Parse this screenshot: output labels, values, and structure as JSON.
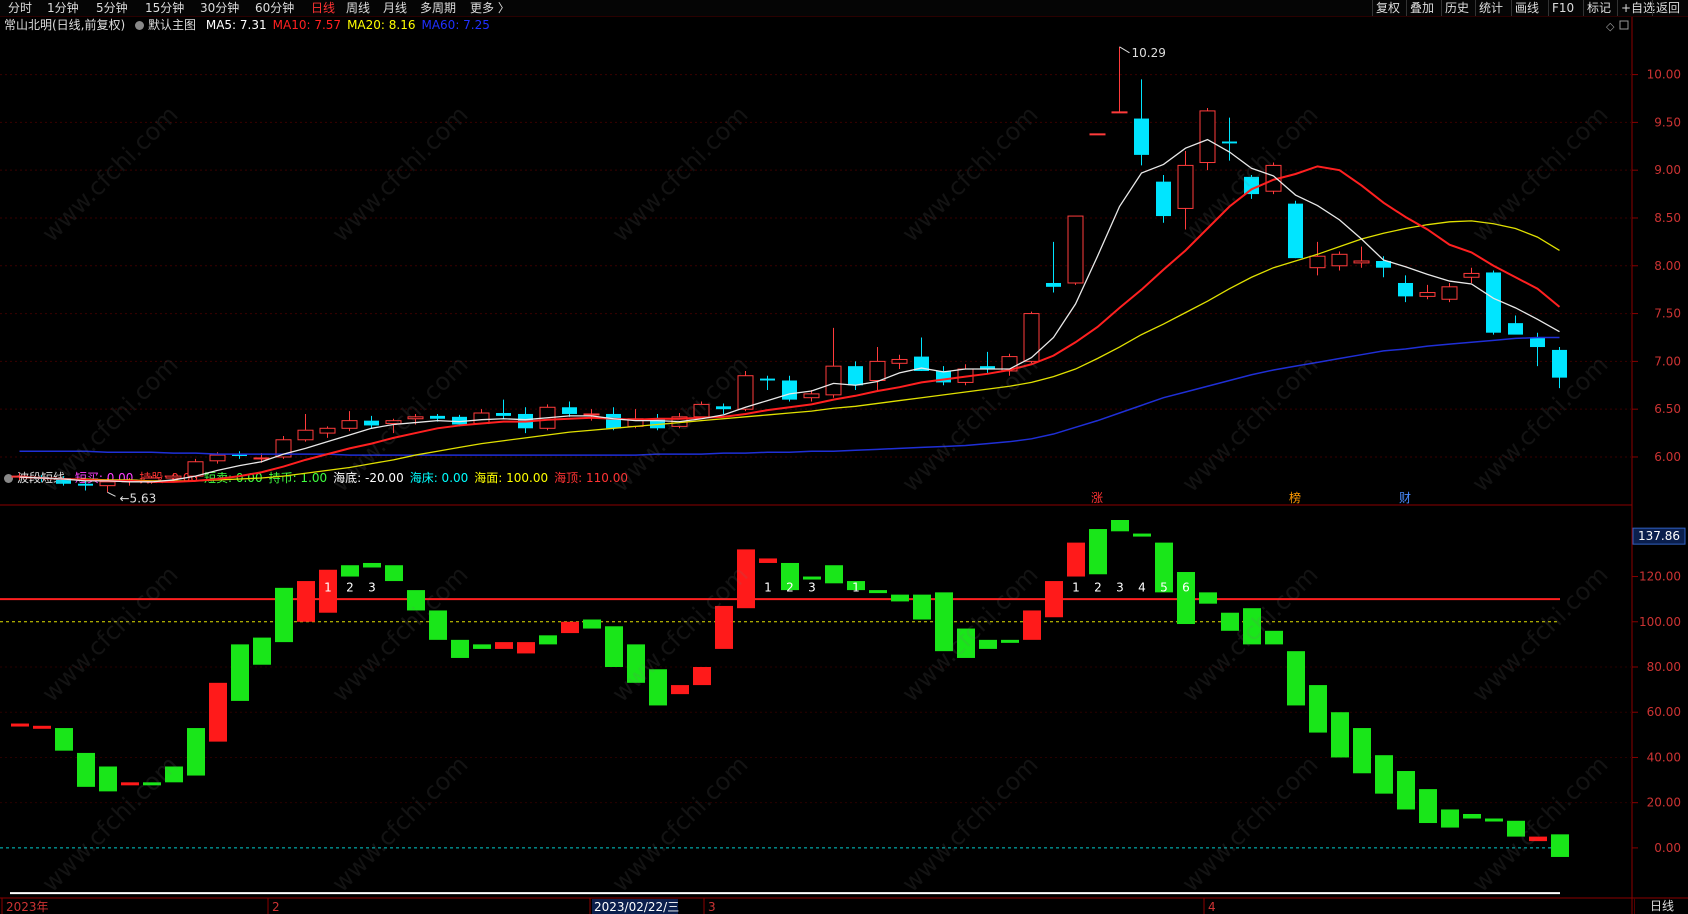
{
  "toolbar": {
    "periods": [
      {
        "label": "分时",
        "x": 22
      },
      {
        "label": "1分钟",
        "x": 61
      },
      {
        "label": "5分钟",
        "x": 110
      },
      {
        "label": "15分钟",
        "x": 159
      },
      {
        "label": "30分钟",
        "x": 214
      },
      {
        "label": "60分钟",
        "x": 269
      },
      {
        "label": "日线",
        "x": 325,
        "active": true
      },
      {
        "label": "周线",
        "x": 360
      },
      {
        "label": "月线",
        "x": 397
      },
      {
        "label": "多周期",
        "x": 434
      },
      {
        "label": "更多 〉",
        "x": 484
      }
    ],
    "right_items": [
      "复权",
      "叠加",
      "历史",
      "统计",
      "画线",
      "F10",
      "标记",
      "+自选",
      "返回"
    ]
  },
  "main_chart": {
    "title": "常山北明(日线,前复权)",
    "template": "默认主图",
    "ma": [
      {
        "label": "MA5: 7.31",
        "color": "#ffffff"
      },
      {
        "label": "MA10: 7.57",
        "color": "#ff2020"
      },
      {
        "label": "MA20: 8.16",
        "color": "#ffff00"
      },
      {
        "label": "MA60: 7.25",
        "color": "#2030ff"
      }
    ],
    "y_ticks": [
      "10.00",
      "9.50",
      "9.00",
      "8.50",
      "8.00",
      "7.50",
      "7.00",
      "6.50",
      "6.00"
    ],
    "max_label": "10.29",
    "min_label": "5.63",
    "markers": [
      {
        "text": "涨",
        "color": "#ff3333"
      },
      {
        "text": "榜",
        "color": "#ff9900"
      },
      {
        "text": "财",
        "color": "#4a8cff"
      }
    ]
  },
  "indicator": {
    "name": "波段短线",
    "params": [
      {
        "label": "短买: 0.00",
        "color": "#ff40ff"
      },
      {
        "label": "持股: 0.00",
        "color": "#ff3333"
      },
      {
        "label": "短卖: 0.00",
        "color": "#40ff40"
      },
      {
        "label": "持币: 1.00",
        "color": "#40ff40"
      },
      {
        "label": "海底: -20.00",
        "color": "#ffffff"
      },
      {
        "label": "海床: 0.00",
        "color": "#00ffff"
      },
      {
        "label": "海面: 100.00",
        "color": "#ffff00"
      },
      {
        "label": "海顶: 110.00",
        "color": "#ff3333"
      }
    ],
    "y_ticks": [
      "120.00",
      "100.00",
      "80.00",
      "60.00",
      "40.00",
      "20.00",
      "0.00"
    ],
    "current_value": "137.86",
    "count_labels": [
      "1",
      "2",
      "3",
      "1",
      "2",
      "3",
      "1",
      "1",
      "2",
      "3",
      "4",
      "5",
      "6"
    ]
  },
  "x_axis": {
    "labels": [
      "2023年",
      "2",
      "2023/02/22/三",
      "3",
      "4"
    ],
    "period_button": "日线"
  },
  "watermark": "www.cfchi.com",
  "chart_data": {
    "type": "candlestick",
    "candles_ohlc": [
      [
        5.79,
        5.83,
        5.76,
        5.8
      ],
      [
        5.79,
        5.81,
        5.74,
        5.77
      ],
      [
        5.78,
        5.8,
        5.7,
        5.72
      ],
      [
        5.72,
        5.75,
        5.65,
        5.7
      ],
      [
        5.7,
        5.78,
        5.63,
        5.74
      ],
      [
        5.74,
        5.78,
        5.7,
        5.76
      ],
      [
        5.75,
        5.8,
        5.72,
        5.78
      ],
      [
        5.78,
        5.83,
        5.74,
        5.8
      ],
      [
        5.8,
        5.98,
        5.78,
        5.95
      ],
      [
        5.96,
        6.05,
        5.93,
        6.02
      ],
      [
        6.03,
        6.06,
        5.98,
        6.01
      ],
      [
        5.98,
        6.04,
        5.94,
        5.99
      ],
      [
        6.0,
        6.22,
        5.98,
        6.18
      ],
      [
        6.18,
        6.45,
        6.16,
        6.28
      ],
      [
        6.25,
        6.32,
        6.2,
        6.3
      ],
      [
        6.3,
        6.48,
        6.27,
        6.38
      ],
      [
        6.38,
        6.43,
        6.3,
        6.33
      ],
      [
        6.35,
        6.4,
        6.25,
        6.38
      ],
      [
        6.4,
        6.45,
        6.34,
        6.42
      ],
      [
        6.43,
        6.45,
        6.37,
        6.4
      ],
      [
        6.42,
        6.44,
        6.32,
        6.34
      ],
      [
        6.35,
        6.5,
        6.34,
        6.46
      ],
      [
        6.46,
        6.6,
        6.4,
        6.43
      ],
      [
        6.45,
        6.52,
        6.25,
        6.3
      ],
      [
        6.3,
        6.55,
        6.28,
        6.52
      ],
      [
        6.52,
        6.58,
        6.42,
        6.45
      ],
      [
        6.45,
        6.5,
        6.38,
        6.45
      ],
      [
        6.45,
        6.52,
        6.28,
        6.3
      ],
      [
        6.32,
        6.5,
        6.3,
        6.4
      ],
      [
        6.4,
        6.45,
        6.28,
        6.3
      ],
      [
        6.32,
        6.46,
        6.3,
        6.42
      ],
      [
        6.42,
        6.58,
        6.4,
        6.55
      ],
      [
        6.53,
        6.56,
        6.45,
        6.5
      ],
      [
        6.5,
        6.9,
        6.48,
        6.85
      ],
      [
        6.82,
        6.85,
        6.7,
        6.8
      ],
      [
        6.8,
        6.85,
        6.58,
        6.6
      ],
      [
        6.62,
        6.7,
        6.58,
        6.66
      ],
      [
        6.65,
        7.35,
        6.62,
        6.95
      ],
      [
        6.95,
        7.0,
        6.7,
        6.75
      ],
      [
        6.8,
        7.15,
        6.7,
        7.0
      ],
      [
        6.98,
        7.07,
        6.92,
        7.02
      ],
      [
        7.05,
        7.25,
        6.9,
        6.9
      ],
      [
        6.9,
        6.95,
        6.75,
        6.78
      ],
      [
        6.78,
        6.97,
        6.75,
        6.92
      ],
      [
        6.95,
        7.1,
        6.88,
        6.92
      ],
      [
        6.9,
        7.08,
        6.85,
        7.05
      ],
      [
        7.0,
        7.52,
        6.98,
        7.5
      ],
      [
        7.82,
        8.25,
        7.72,
        7.78
      ],
      [
        7.82,
        8.52,
        7.8,
        8.52
      ],
      [
        9.38,
        9.38,
        9.38,
        9.38
      ],
      [
        9.61,
        10.29,
        9.61,
        9.61
      ],
      [
        9.54,
        9.95,
        9.05,
        9.16
      ],
      [
        8.88,
        8.95,
        8.45,
        8.52
      ],
      [
        8.6,
        9.2,
        8.38,
        9.05
      ],
      [
        9.08,
        9.65,
        9.0,
        9.62
      ],
      [
        9.3,
        9.55,
        9.1,
        9.28
      ],
      [
        8.93,
        8.95,
        8.7,
        8.75
      ],
      [
        8.78,
        9.08,
        8.75,
        9.05
      ],
      [
        8.65,
        8.68,
        8.08,
        8.08
      ],
      [
        7.98,
        8.25,
        7.9,
        8.1
      ],
      [
        8.0,
        8.15,
        7.95,
        8.12
      ],
      [
        8.03,
        8.2,
        7.98,
        8.05
      ],
      [
        8.05,
        8.1,
        7.88,
        7.98
      ],
      [
        7.82,
        7.9,
        7.62,
        7.68
      ],
      [
        7.68,
        7.8,
        7.65,
        7.72
      ],
      [
        7.65,
        7.82,
        7.62,
        7.78
      ],
      [
        7.88,
        7.98,
        7.82,
        7.92
      ],
      [
        7.93,
        7.95,
        7.28,
        7.3
      ],
      [
        7.4,
        7.48,
        7.3,
        7.28
      ],
      [
        7.25,
        7.3,
        6.95,
        7.15
      ],
      [
        7.12,
        7.15,
        6.72,
        6.83
      ]
    ],
    "ma5": [
      5.79,
      5.78,
      5.77,
      5.75,
      5.75,
      5.74,
      5.74,
      5.76,
      5.8,
      5.86,
      5.91,
      5.95,
      6.03,
      6.09,
      6.16,
      6.23,
      6.3,
      6.34,
      6.36,
      6.38,
      6.37,
      6.39,
      6.4,
      6.39,
      6.41,
      6.43,
      6.43,
      6.4,
      6.38,
      6.38,
      6.37,
      6.4,
      6.44,
      6.52,
      6.59,
      6.66,
      6.69,
      6.77,
      6.75,
      6.79,
      6.88,
      6.93,
      6.89,
      6.92,
      6.92,
      6.92,
      7.04,
      7.25,
      7.6,
      8.1,
      8.62,
      8.97,
      9.06,
      9.23,
      9.32,
      9.19,
      9.02,
      8.94,
      8.74,
      8.63,
      8.48,
      8.28,
      8.06,
      7.99,
      7.91,
      7.84,
      7.81,
      7.66,
      7.56,
      7.44,
      7.31
    ],
    "ma10": [
      5.79,
      5.78,
      5.77,
      5.76,
      5.75,
      5.75,
      5.74,
      5.74,
      5.75,
      5.77,
      5.8,
      5.84,
      5.9,
      5.97,
      6.03,
      6.09,
      6.14,
      6.2,
      6.25,
      6.3,
      6.33,
      6.35,
      6.37,
      6.37,
      6.39,
      6.4,
      6.41,
      6.4,
      6.39,
      6.4,
      6.4,
      6.41,
      6.42,
      6.45,
      6.49,
      6.52,
      6.55,
      6.6,
      6.64,
      6.69,
      6.73,
      6.78,
      6.81,
      6.84,
      6.87,
      6.91,
      6.97,
      7.06,
      7.2,
      7.36,
      7.56,
      7.75,
      7.96,
      8.16,
      8.39,
      8.62,
      8.8,
      8.9,
      8.96,
      9.04,
      9.0,
      8.84,
      8.66,
      8.51,
      8.38,
      8.22,
      8.14,
      8.0,
      7.88,
      7.76,
      7.57
    ],
    "ma20": [
      5.79,
      5.78,
      5.77,
      5.77,
      5.76,
      5.76,
      5.75,
      5.75,
      5.75,
      5.76,
      5.77,
      5.78,
      5.8,
      5.83,
      5.86,
      5.89,
      5.93,
      5.97,
      6.02,
      6.06,
      6.1,
      6.14,
      6.17,
      6.2,
      6.23,
      6.26,
      6.28,
      6.3,
      6.32,
      6.34,
      6.36,
      6.38,
      6.4,
      6.42,
      6.44,
      6.46,
      6.48,
      6.51,
      6.53,
      6.56,
      6.59,
      6.62,
      6.65,
      6.68,
      6.71,
      6.74,
      6.78,
      6.84,
      6.92,
      7.03,
      7.15,
      7.28,
      7.39,
      7.51,
      7.63,
      7.76,
      7.88,
      7.98,
      8.05,
      8.12,
      8.2,
      8.28,
      8.34,
      8.39,
      8.43,
      8.46,
      8.47,
      8.44,
      8.39,
      8.3,
      8.16
    ],
    "ma60": [
      6.06,
      6.06,
      6.06,
      6.06,
      6.05,
      6.05,
      6.05,
      6.04,
      6.04,
      6.03,
      6.03,
      6.03,
      6.03,
      6.03,
      6.03,
      6.02,
      6.02,
      6.02,
      6.02,
      6.02,
      6.02,
      6.02,
      6.02,
      6.02,
      6.02,
      6.02,
      6.02,
      6.02,
      6.02,
      6.03,
      6.03,
      6.03,
      6.04,
      6.04,
      6.05,
      6.05,
      6.06,
      6.06,
      6.07,
      6.08,
      6.09,
      6.1,
      6.11,
      6.12,
      6.14,
      6.16,
      6.19,
      6.24,
      6.31,
      6.38,
      6.46,
      6.54,
      6.62,
      6.68,
      6.74,
      6.8,
      6.86,
      6.91,
      6.95,
      6.99,
      7.03,
      7.07,
      7.11,
      7.13,
      7.16,
      7.18,
      7.2,
      7.22,
      7.24,
      7.25,
      7.25
    ],
    "band_oc": [
      [
        55,
        55
      ],
      [
        54,
        54
      ],
      [
        53,
        43
      ],
      [
        42,
        27
      ],
      [
        36,
        25
      ],
      [
        29,
        29
      ],
      [
        29,
        28
      ],
      [
        36,
        29
      ],
      [
        53,
        32
      ],
      [
        47,
        73
      ],
      [
        90,
        65
      ],
      [
        93,
        81
      ],
      [
        115,
        91
      ],
      [
        100,
        118
      ],
      [
        104,
        123
      ],
      [
        125,
        120
      ],
      [
        126,
        124
      ],
      [
        125,
        118
      ],
      [
        114,
        105
      ],
      [
        105,
        92
      ],
      [
        92,
        84
      ],
      [
        90,
        88
      ],
      [
        88,
        91
      ],
      [
        86,
        91
      ],
      [
        94,
        90
      ],
      [
        95,
        100
      ],
      [
        101,
        97
      ],
      [
        98,
        80
      ],
      [
        90,
        73
      ],
      [
        79,
        63
      ],
      [
        68,
        72
      ],
      [
        72,
        80
      ],
      [
        88,
        107
      ],
      [
        106,
        132
      ],
      [
        126,
        128
      ],
      [
        126,
        114
      ],
      [
        120,
        119
      ],
      [
        125,
        117
      ],
      [
        118,
        114
      ],
      [
        114,
        113
      ],
      [
        112,
        109
      ],
      [
        112,
        101
      ],
      [
        113,
        87
      ],
      [
        97,
        84
      ],
      [
        92,
        88
      ],
      [
        92,
        91
      ],
      [
        92,
        105
      ],
      [
        102,
        118
      ],
      [
        120,
        135
      ],
      [
        141,
        121
      ],
      [
        145,
        140
      ],
      [
        139,
        138
      ],
      [
        135,
        113
      ],
      [
        122,
        99
      ],
      [
        113,
        108
      ],
      [
        104,
        96
      ],
      [
        106,
        90
      ],
      [
        96,
        90
      ],
      [
        87,
        63
      ],
      [
        72,
        51
      ],
      [
        60,
        40
      ],
      [
        53,
        33
      ],
      [
        41,
        24
      ],
      [
        34,
        17
      ],
      [
        26,
        11
      ],
      [
        17,
        9
      ],
      [
        15,
        13
      ],
      [
        13,
        12
      ],
      [
        12,
        5
      ],
      [
        3,
        5
      ],
      [
        6,
        -4
      ]
    ],
    "band_ylim": [
      -8,
      145
    ],
    "main_ylim": [
      5.55,
      10.55
    ]
  }
}
